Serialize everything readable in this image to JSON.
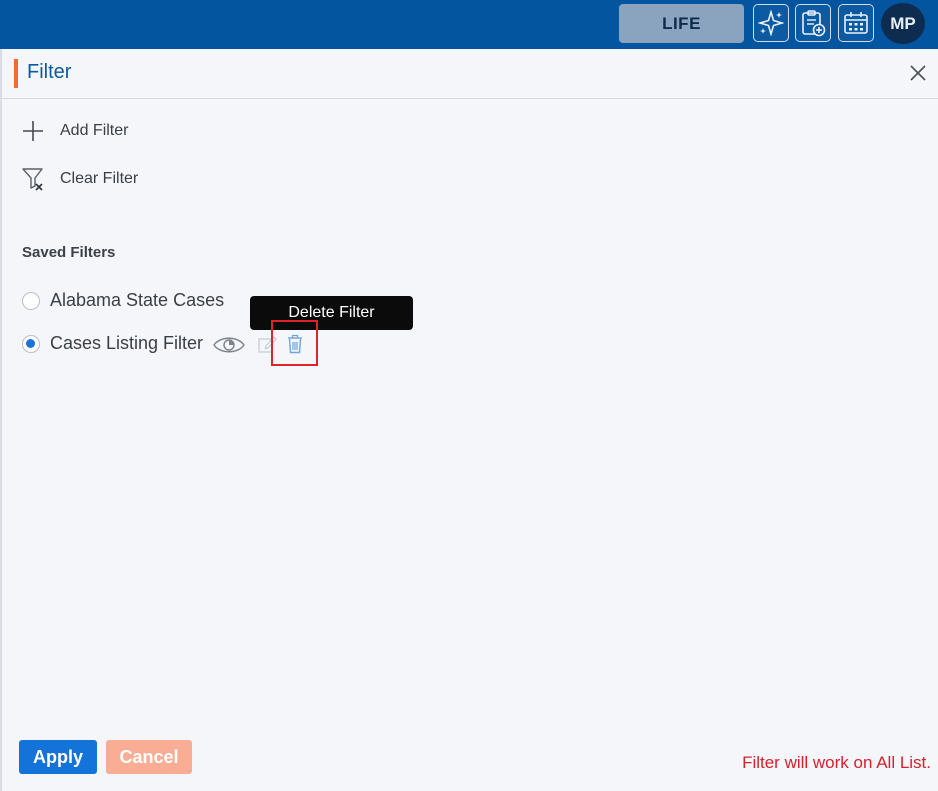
{
  "topbar": {
    "product_label": "LIFE",
    "avatar_initials": "MP",
    "icons": [
      "sparkle-icon",
      "clipboard-add-icon",
      "calendar-icon"
    ],
    "background": "#04559f"
  },
  "panel": {
    "title": "Filter",
    "accent_color": "#f26a2e",
    "close_icon": "close-icon"
  },
  "actions": {
    "add_filter": "Add Filter",
    "clear_filter": "Clear Filter"
  },
  "saved_filters": {
    "heading": "Saved Filters",
    "items": [
      {
        "label": "Alabama State Cases",
        "selected": false
      },
      {
        "label": "Cases Listing Filter",
        "selected": true
      }
    ]
  },
  "tooltip": {
    "text": "Delete Filter"
  },
  "footer": {
    "apply_label": "Apply",
    "cancel_label": "Cancel",
    "note": "Filter will work on All List."
  }
}
